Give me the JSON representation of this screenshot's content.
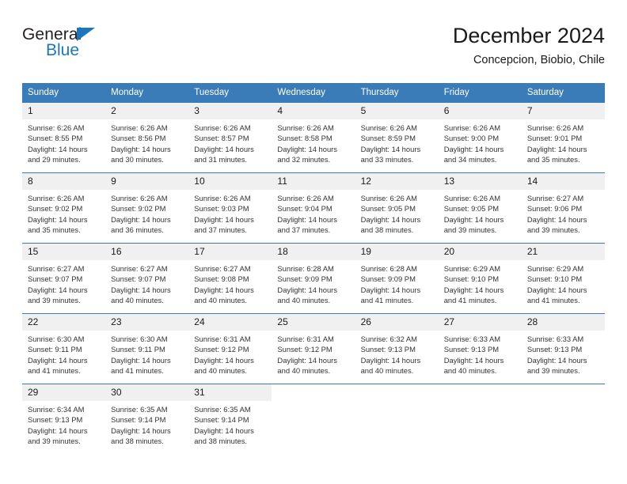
{
  "brand": {
    "name_part1": "General",
    "name_part2": "Blue",
    "triangle_color": "#1b76bd"
  },
  "header": {
    "title": "December 2024",
    "location": "Concepcion, Biobio, Chile"
  },
  "theme": {
    "header_blue": "#3a7cb8",
    "daynum_bg": "#f0f0f0",
    "text": "#333333"
  },
  "weekdays": [
    "Sunday",
    "Monday",
    "Tuesday",
    "Wednesday",
    "Thursday",
    "Friday",
    "Saturday"
  ],
  "labels": {
    "sunrise": "Sunrise:",
    "sunset": "Sunset:",
    "daylight": "Daylight:"
  },
  "weeks": [
    [
      {
        "day": "1",
        "sunrise": "Sunrise: 6:26 AM",
        "sunset": "Sunset: 8:55 PM",
        "daylight_1": "Daylight: 14 hours",
        "daylight_2": "and 29 minutes."
      },
      {
        "day": "2",
        "sunrise": "Sunrise: 6:26 AM",
        "sunset": "Sunset: 8:56 PM",
        "daylight_1": "Daylight: 14 hours",
        "daylight_2": "and 30 minutes."
      },
      {
        "day": "3",
        "sunrise": "Sunrise: 6:26 AM",
        "sunset": "Sunset: 8:57 PM",
        "daylight_1": "Daylight: 14 hours",
        "daylight_2": "and 31 minutes."
      },
      {
        "day": "4",
        "sunrise": "Sunrise: 6:26 AM",
        "sunset": "Sunset: 8:58 PM",
        "daylight_1": "Daylight: 14 hours",
        "daylight_2": "and 32 minutes."
      },
      {
        "day": "5",
        "sunrise": "Sunrise: 6:26 AM",
        "sunset": "Sunset: 8:59 PM",
        "daylight_1": "Daylight: 14 hours",
        "daylight_2": "and 33 minutes."
      },
      {
        "day": "6",
        "sunrise": "Sunrise: 6:26 AM",
        "sunset": "Sunset: 9:00 PM",
        "daylight_1": "Daylight: 14 hours",
        "daylight_2": "and 34 minutes."
      },
      {
        "day": "7",
        "sunrise": "Sunrise: 6:26 AM",
        "sunset": "Sunset: 9:01 PM",
        "daylight_1": "Daylight: 14 hours",
        "daylight_2": "and 35 minutes."
      }
    ],
    [
      {
        "day": "8",
        "sunrise": "Sunrise: 6:26 AM",
        "sunset": "Sunset: 9:02 PM",
        "daylight_1": "Daylight: 14 hours",
        "daylight_2": "and 35 minutes."
      },
      {
        "day": "9",
        "sunrise": "Sunrise: 6:26 AM",
        "sunset": "Sunset: 9:02 PM",
        "daylight_1": "Daylight: 14 hours",
        "daylight_2": "and 36 minutes."
      },
      {
        "day": "10",
        "sunrise": "Sunrise: 6:26 AM",
        "sunset": "Sunset: 9:03 PM",
        "daylight_1": "Daylight: 14 hours",
        "daylight_2": "and 37 minutes."
      },
      {
        "day": "11",
        "sunrise": "Sunrise: 6:26 AM",
        "sunset": "Sunset: 9:04 PM",
        "daylight_1": "Daylight: 14 hours",
        "daylight_2": "and 37 minutes."
      },
      {
        "day": "12",
        "sunrise": "Sunrise: 6:26 AM",
        "sunset": "Sunset: 9:05 PM",
        "daylight_1": "Daylight: 14 hours",
        "daylight_2": "and 38 minutes."
      },
      {
        "day": "13",
        "sunrise": "Sunrise: 6:26 AM",
        "sunset": "Sunset: 9:05 PM",
        "daylight_1": "Daylight: 14 hours",
        "daylight_2": "and 39 minutes."
      },
      {
        "day": "14",
        "sunrise": "Sunrise: 6:27 AM",
        "sunset": "Sunset: 9:06 PM",
        "daylight_1": "Daylight: 14 hours",
        "daylight_2": "and 39 minutes."
      }
    ],
    [
      {
        "day": "15",
        "sunrise": "Sunrise: 6:27 AM",
        "sunset": "Sunset: 9:07 PM",
        "daylight_1": "Daylight: 14 hours",
        "daylight_2": "and 39 minutes."
      },
      {
        "day": "16",
        "sunrise": "Sunrise: 6:27 AM",
        "sunset": "Sunset: 9:07 PM",
        "daylight_1": "Daylight: 14 hours",
        "daylight_2": "and 40 minutes."
      },
      {
        "day": "17",
        "sunrise": "Sunrise: 6:27 AM",
        "sunset": "Sunset: 9:08 PM",
        "daylight_1": "Daylight: 14 hours",
        "daylight_2": "and 40 minutes."
      },
      {
        "day": "18",
        "sunrise": "Sunrise: 6:28 AM",
        "sunset": "Sunset: 9:09 PM",
        "daylight_1": "Daylight: 14 hours",
        "daylight_2": "and 40 minutes."
      },
      {
        "day": "19",
        "sunrise": "Sunrise: 6:28 AM",
        "sunset": "Sunset: 9:09 PM",
        "daylight_1": "Daylight: 14 hours",
        "daylight_2": "and 41 minutes."
      },
      {
        "day": "20",
        "sunrise": "Sunrise: 6:29 AM",
        "sunset": "Sunset: 9:10 PM",
        "daylight_1": "Daylight: 14 hours",
        "daylight_2": "and 41 minutes."
      },
      {
        "day": "21",
        "sunrise": "Sunrise: 6:29 AM",
        "sunset": "Sunset: 9:10 PM",
        "daylight_1": "Daylight: 14 hours",
        "daylight_2": "and 41 minutes."
      }
    ],
    [
      {
        "day": "22",
        "sunrise": "Sunrise: 6:30 AM",
        "sunset": "Sunset: 9:11 PM",
        "daylight_1": "Daylight: 14 hours",
        "daylight_2": "and 41 minutes."
      },
      {
        "day": "23",
        "sunrise": "Sunrise: 6:30 AM",
        "sunset": "Sunset: 9:11 PM",
        "daylight_1": "Daylight: 14 hours",
        "daylight_2": "and 41 minutes."
      },
      {
        "day": "24",
        "sunrise": "Sunrise: 6:31 AM",
        "sunset": "Sunset: 9:12 PM",
        "daylight_1": "Daylight: 14 hours",
        "daylight_2": "and 40 minutes."
      },
      {
        "day": "25",
        "sunrise": "Sunrise: 6:31 AM",
        "sunset": "Sunset: 9:12 PM",
        "daylight_1": "Daylight: 14 hours",
        "daylight_2": "and 40 minutes."
      },
      {
        "day": "26",
        "sunrise": "Sunrise: 6:32 AM",
        "sunset": "Sunset: 9:13 PM",
        "daylight_1": "Daylight: 14 hours",
        "daylight_2": "and 40 minutes."
      },
      {
        "day": "27",
        "sunrise": "Sunrise: 6:33 AM",
        "sunset": "Sunset: 9:13 PM",
        "daylight_1": "Daylight: 14 hours",
        "daylight_2": "and 40 minutes."
      },
      {
        "day": "28",
        "sunrise": "Sunrise: 6:33 AM",
        "sunset": "Sunset: 9:13 PM",
        "daylight_1": "Daylight: 14 hours",
        "daylight_2": "and 39 minutes."
      }
    ],
    [
      {
        "day": "29",
        "sunrise": "Sunrise: 6:34 AM",
        "sunset": "Sunset: 9:13 PM",
        "daylight_1": "Daylight: 14 hours",
        "daylight_2": "and 39 minutes."
      },
      {
        "day": "30",
        "sunrise": "Sunrise: 6:35 AM",
        "sunset": "Sunset: 9:14 PM",
        "daylight_1": "Daylight: 14 hours",
        "daylight_2": "and 38 minutes."
      },
      {
        "day": "31",
        "sunrise": "Sunrise: 6:35 AM",
        "sunset": "Sunset: 9:14 PM",
        "daylight_1": "Daylight: 14 hours",
        "daylight_2": "and 38 minutes."
      },
      {
        "day": "",
        "sunrise": "",
        "sunset": "",
        "daylight_1": "",
        "daylight_2": ""
      },
      {
        "day": "",
        "sunrise": "",
        "sunset": "",
        "daylight_1": "",
        "daylight_2": ""
      },
      {
        "day": "",
        "sunrise": "",
        "sunset": "",
        "daylight_1": "",
        "daylight_2": ""
      },
      {
        "day": "",
        "sunrise": "",
        "sunset": "",
        "daylight_1": "",
        "daylight_2": ""
      }
    ]
  ]
}
